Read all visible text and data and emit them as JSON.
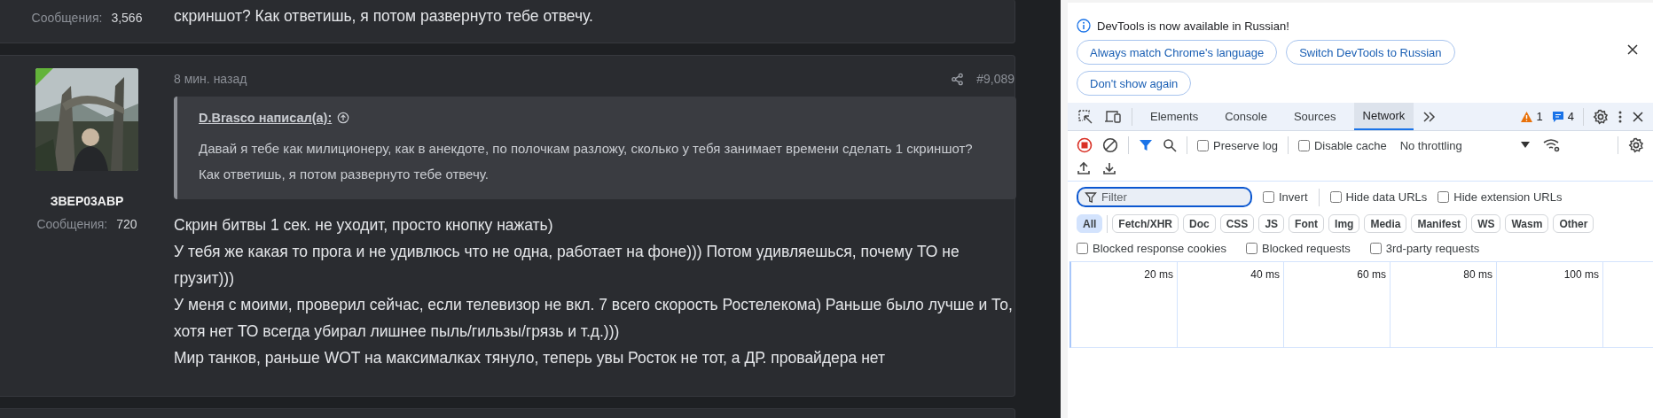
{
  "forum": {
    "prev_post": {
      "stat_label": "Сообщения:",
      "stat_value": "3,566",
      "text_tail": "скриншот? Как ответишь, я потом развернуто тебе отвечу."
    },
    "post": {
      "avatar": {
        "kind": "picture",
        "online": true
      },
      "author": "ЗВЕР03АВР",
      "stat_label": "Сообщения:",
      "stat_value": "720",
      "time": "8 мин. назад",
      "number": "#9,089",
      "quote": {
        "author": "D.Brasco написал(а):",
        "lines": [
          "Давай я тебе как милиционеру, как в анекдоте, по полочкам разложу, сколько у тебя занимает времени сделать 1 скриншот?",
          "Как ответишь, я потом развернуто тебе отвечу."
        ]
      },
      "paragraphs": [
        "Скрин битвы 1 сек. не уходит, просто кнопку нажать)",
        "У тебя же какая то прога и не удивлюсь что не одна, работает на фоне))) Потом удивляешься, почему ТО не грузит)))",
        "У меня с моими, проверил сейчас, если телевизор не вкл. 7 всего скорость Ростелекома) Раньше было лучше и То, хотя нет ТО всегда убирал лишнее пыль/гильзы/грязь и т.д.)))",
        "Мир танков, раньше WOT на максималках тянуло, теперь увы Росток не тот, а ДР. провайдера нет"
      ]
    }
  },
  "devtools": {
    "infobar": {
      "message": "DevTools is now available in Russian!",
      "buttons": [
        "Always match Chrome's language",
        "Switch DevTools to Russian",
        "Don't show again"
      ]
    },
    "tabs": [
      {
        "label": "Elements",
        "selected": false
      },
      {
        "label": "Console",
        "selected": false
      },
      {
        "label": "Sources",
        "selected": false
      },
      {
        "label": "Network",
        "selected": true
      }
    ],
    "warnings": "1",
    "messages": "4",
    "toolbar": {
      "preserve_log": {
        "label": "Preserve log",
        "checked": false
      },
      "disable_cache": {
        "label": "Disable cache",
        "checked": false
      },
      "throttling": "No throttling"
    },
    "filter": {
      "placeholder": "Filter",
      "options": [
        {
          "label": "Invert",
          "checked": false
        },
        {
          "label": "Hide data URLs",
          "checked": false
        },
        {
          "label": "Hide extension URLs",
          "checked": false
        }
      ]
    },
    "types": [
      {
        "label": "All",
        "selected": true
      },
      {
        "label": "Fetch/XHR",
        "selected": false
      },
      {
        "label": "Doc",
        "selected": false
      },
      {
        "label": "CSS",
        "selected": false
      },
      {
        "label": "JS",
        "selected": false
      },
      {
        "label": "Font",
        "selected": false
      },
      {
        "label": "Img",
        "selected": false
      },
      {
        "label": "Media",
        "selected": false
      },
      {
        "label": "Manifest",
        "selected": false
      },
      {
        "label": "WS",
        "selected": false
      },
      {
        "label": "Wasm",
        "selected": false
      },
      {
        "label": "Other",
        "selected": false
      }
    ],
    "blocked": [
      {
        "label": "Blocked response cookies",
        "checked": false
      },
      {
        "label": "Blocked requests",
        "checked": false
      },
      {
        "label": "3rd-party requests",
        "checked": false
      }
    ],
    "timeline_ticks": [
      "20 ms",
      "40 ms",
      "60 ms",
      "80 ms",
      "100 ms"
    ]
  }
}
